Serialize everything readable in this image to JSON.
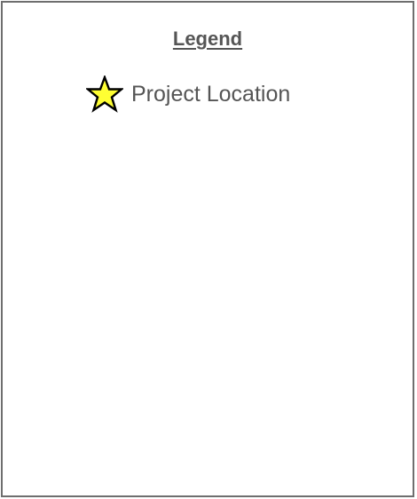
{
  "legend": {
    "title": "Legend",
    "entries": [
      {
        "icon": "star-icon",
        "label": "Project Location",
        "fill_color": "#ffff33",
        "stroke_color": "#000000"
      }
    ]
  },
  "colors": {
    "border": "#6e6e6e",
    "text": "#555555"
  }
}
